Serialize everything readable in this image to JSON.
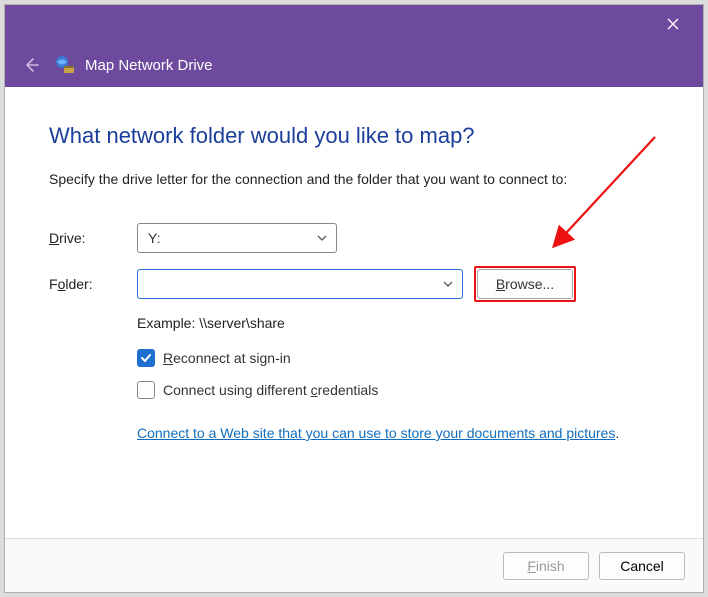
{
  "titlebar": {
    "wizard_title": "Map Network Drive"
  },
  "content": {
    "heading": "What network folder would you like to map?",
    "instruction": "Specify the drive letter for the connection and the folder that you want to connect to:",
    "drive_label_pre": "D",
    "drive_label_post": "rive:",
    "drive_value": "Y:",
    "folder_label_pre": "F",
    "folder_label_mid": "o",
    "folder_label_post": "lder:",
    "folder_value": "",
    "browse_label_pre": "B",
    "browse_label_post": "rowse...",
    "example_text": "Example: \\\\server\\share",
    "reconnect_pre": "R",
    "reconnect_post": "econnect at sign-in",
    "credentials_pre": "Connect using different ",
    "credentials_mid": "c",
    "credentials_post": "redentials",
    "link_text": "Connect to a Web site that you can use to store your documents and pictures",
    "link_dot": "."
  },
  "footer": {
    "finish_pre": "F",
    "finish_post": "inish",
    "cancel_label": "Cancel"
  }
}
